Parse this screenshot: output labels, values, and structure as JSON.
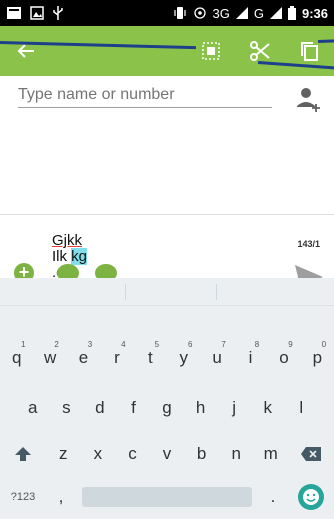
{
  "status_bar": {
    "time": "9:36",
    "network_3g": "3G",
    "network_g": "G"
  },
  "recipient": {
    "placeholder": "Type name or number"
  },
  "compose": {
    "line1": "Gjkk",
    "line2_plain": "Ilk ",
    "line2_highlight": "kg",
    "line3": ".oh",
    "counter": "143/1"
  },
  "keyboard": {
    "row1": [
      {
        "key": "q",
        "hint": "1"
      },
      {
        "key": "w",
        "hint": "2"
      },
      {
        "key": "e",
        "hint": "3"
      },
      {
        "key": "r",
        "hint": "4"
      },
      {
        "key": "t",
        "hint": "5"
      },
      {
        "key": "y",
        "hint": "6"
      },
      {
        "key": "u",
        "hint": "7"
      },
      {
        "key": "i",
        "hint": "8"
      },
      {
        "key": "o",
        "hint": "9"
      },
      {
        "key": "p",
        "hint": "0"
      }
    ],
    "row2": [
      "a",
      "s",
      "d",
      "f",
      "g",
      "h",
      "j",
      "k",
      "l"
    ],
    "row3": [
      "z",
      "x",
      "c",
      "v",
      "b",
      "n",
      "m"
    ],
    "symbols_label": "?123",
    "comma": ",",
    "period": "."
  },
  "colors": {
    "action_bar": "#8bc34a",
    "accent": "#7cb342",
    "emoji_button": "#26a69a"
  }
}
